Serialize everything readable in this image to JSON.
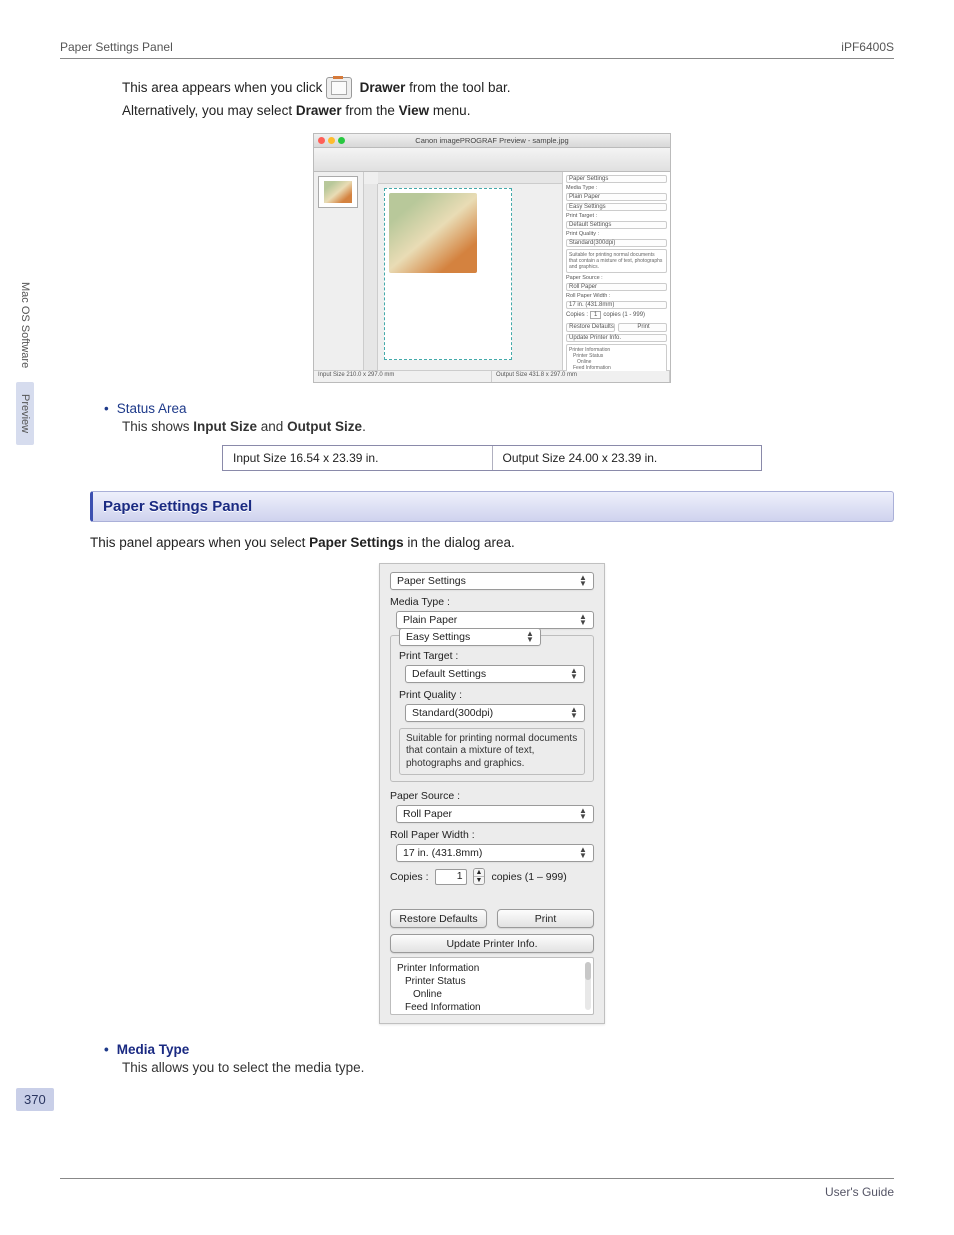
{
  "header": {
    "left": "Paper Settings Panel",
    "right": "iPF6400S"
  },
  "sideTabs": {
    "tab1": "Mac OS Software",
    "tab2": "Preview"
  },
  "intro": {
    "text1a": "This area appears when you click ",
    "drawer": "Drawer",
    "text1b": " from the tool bar.",
    "text2a": "Alternatively, you may select ",
    "text2b": " from the ",
    "view": "View",
    "text2c": " menu."
  },
  "previewWindow": {
    "title": "Canon imagePROGRAF Preview - sample.jpg",
    "statusLeft": "Input Size 210.0 x 297.0 mm",
    "statusRight": "Output Size 431.8 x 297.0 mm",
    "side": {
      "paperSettings": "Paper Settings",
      "mediaType": "Media Type :",
      "plainPaper": "Plain Paper",
      "easySettings": "Easy Settings",
      "printTarget": "Print Target :",
      "defaultSettings": "Default Settings",
      "printQuality": "Print Quality :",
      "standard": "Standard(300dpi)",
      "helpText": "Suitable for printing normal documents that contain a mixture of text, photographs and graphics.",
      "paperSource": "Paper Source :",
      "rollPaper": "Roll Paper",
      "rollWidth": "Roll Paper Width :",
      "rollWidthVal": "17 in. (431.8mm)",
      "copies": "Copies :",
      "copiesVal": "1",
      "copiesRange": "copies (1 - 999)",
      "restore": "Restore Defaults",
      "print": "Print",
      "update": "Update Printer Info.",
      "printerInfo": "Printer Information",
      "printerStatus": "Printer Status",
      "online": "Online",
      "feedInfo": "Feed Information"
    }
  },
  "statusArea": {
    "heading": "Status Area",
    "desc_a": "This shows ",
    "desc_b": "Input Size",
    "desc_c": " and ",
    "desc_d": "Output Size",
    "desc_e": ".",
    "stripLeft": "Input Size 16.54 x 23.39 in.",
    "stripRight": "Output Size 24.00 x 23.39 in."
  },
  "section": {
    "title": "Paper Settings Panel",
    "desc_a": "This panel appears when you select ",
    "desc_b": "Paper Settings",
    "desc_c": " in the dialog area."
  },
  "panel": {
    "paperSettings": "Paper Settings",
    "mediaType": "Media Type :",
    "plainPaper": "Plain Paper",
    "easySettings": "Easy Settings",
    "printTarget": "Print Target :",
    "defaultSettings": "Default Settings",
    "printQuality": "Print Quality :",
    "standard": "Standard(300dpi)",
    "helpText": "Suitable for printing normal documents that contain a mixture of text, photographs and graphics.",
    "paperSource": "Paper Source :",
    "rollPaper": "Roll Paper",
    "rollWidth": "Roll Paper Width :",
    "rollWidthVal": "17 in. (431.8mm)",
    "copies": "Copies :",
    "copiesVal": "1",
    "copiesRange": "copies (1 – 999)",
    "restore": "Restore Defaults",
    "print": "Print",
    "update": "Update Printer Info.",
    "printerInfo": "Printer Information",
    "printerStatus": "Printer Status",
    "online": "Online",
    "feedInfo": "Feed Information"
  },
  "mediaTypeSection": {
    "heading": "Media Type",
    "desc": "This allows you to select the media type."
  },
  "pageNumber": "370",
  "footer": "User's Guide"
}
